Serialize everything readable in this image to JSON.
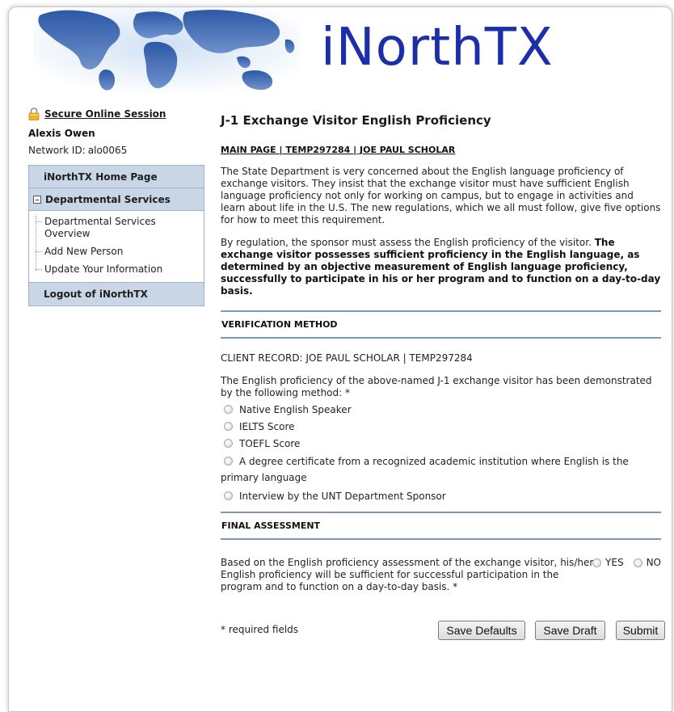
{
  "header": {
    "brand": "iNorthTX"
  },
  "sidebar": {
    "secure_link": "Secure Online Session",
    "user_name": "Alexis Owen",
    "network_label": "Network ID:",
    "network_id": "alo0065",
    "nav": {
      "home": "iNorthTX Home Page",
      "dept_services": "Departmental Services",
      "sub_items": [
        "Departmental Services Overview",
        "Add New Person",
        "Update Your Information"
      ],
      "logout": "Logout of iNorthTX"
    }
  },
  "main": {
    "title": "J-1 Exchange Visitor English Proficiency",
    "breadcrumb": "MAIN PAGE | TEMP297284 | JOE PAUL SCHOLAR",
    "intro_paragraph": "The State Department is very concerned about the English language proficiency of exchange visitors. They insist that the exchange visitor must have sufficient English language proficiency not only for working on campus, but to engage in activities and learn about life in the U.S. The new regulations, which we all must follow, give five options for how to meet this requirement.",
    "regulation_lead": "By regulation, the sponsor must assess the English proficiency of the visitor. ",
    "regulation_bold": "The exchange visitor possesses sufficient proficiency in the English language, as determined by an objective measurement of English language proficiency, successfully to participate in his or her program and to function on a day-to-day basis.",
    "verification_heading": "VERIFICATION METHOD",
    "client_record": "CLIENT RECORD: JOE PAUL SCHOLAR | TEMP297284",
    "method_intro": "The English proficiency of the above-named J-1 exchange visitor has been demonstrated by the following method: *",
    "methods": [
      "Native English Speaker",
      "IELTS Score",
      "TOEFL Score",
      "A degree certificate from a recognized academic institution where English is the primary language",
      "Interview by the UNT Department Sponsor"
    ],
    "final_heading": "FINAL ASSESSMENT",
    "assessment_text": "Based on the English proficiency assessment of the exchange visitor, his/her English proficiency will be sufficient for successful participation in the program and to function on a day-to-day basis. *",
    "yes_label": "YES",
    "no_label": "NO",
    "required_note": "* required fields",
    "buttons": {
      "save_defaults": "Save Defaults",
      "save_draft": "Save Draft",
      "submit": "Submit"
    }
  },
  "colors": {
    "brand": "#1c2ea8",
    "nav_header_bg": "#c9d6e6",
    "section_rule": "#7b98b6"
  }
}
